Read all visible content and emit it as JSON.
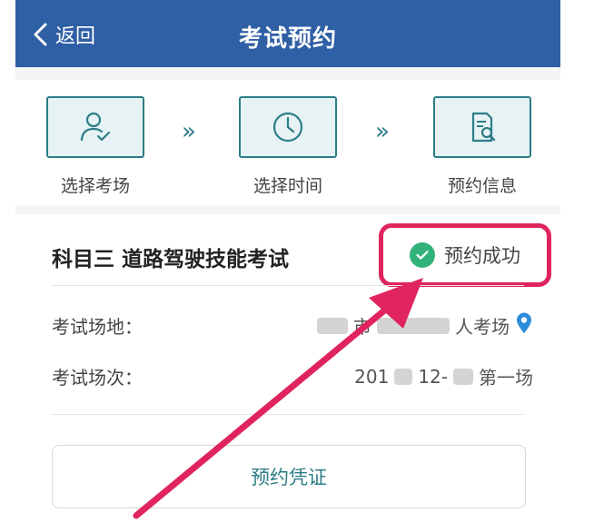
{
  "header": {
    "back_label": "返回",
    "title": "考试预约"
  },
  "steps": [
    {
      "label": "选择考场",
      "icon": "person-check-icon"
    },
    {
      "label": "选择时间",
      "icon": "clock-icon"
    },
    {
      "label": "预约信息",
      "icon": "document-search-icon"
    }
  ],
  "step_separator": "»",
  "card": {
    "subject": "科目三 道路驾驶技能考试",
    "status": "预约成功",
    "venue_label": "考试场地：",
    "venue_value_parts": [
      "市",
      "人考场"
    ],
    "session_label": "考试场次：",
    "session_value_parts": [
      "201",
      "12-",
      "第一场"
    ],
    "voucher_button": "预约凭证"
  },
  "colors": {
    "header_bg": "#2f5fa5",
    "accent_teal": "#2c7d86",
    "highlight_red": "#e0245e",
    "success_green": "#32b27a",
    "location_pin": "#2a8bd9"
  }
}
